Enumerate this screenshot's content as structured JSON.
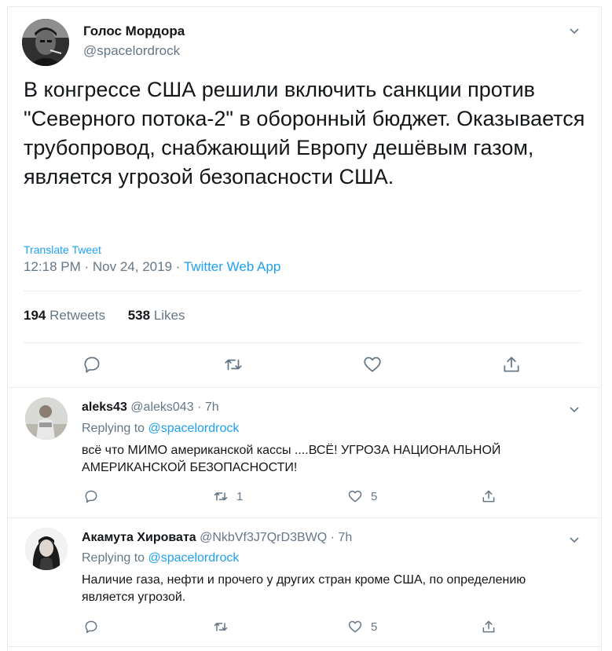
{
  "main_tweet": {
    "author_name": "Голос Мордора",
    "author_handle": "@spacelordrock",
    "text": "В конгрессе США решили включить санкции против \"Северного потока-2\" в оборонный бюджет. Оказывается трубопровод, снабжающий Европу дешёвым газом, является угрозой безопасности США.",
    "translate_label": "Translate Tweet",
    "time": "12:18 PM",
    "date": "Nov 24, 2019",
    "source": "Twitter Web App",
    "retweets_count": "194",
    "retweets_label": "Retweets",
    "likes_count": "538",
    "likes_label": "Likes"
  },
  "replies": [
    {
      "name": "aleks43",
      "handle": "@aleks043",
      "time": "7h",
      "replying_prefix": "Replying to",
      "replying_to": "@spacelordrock",
      "text": "всё что МИМО американской кассы ....ВСЁ! УГРОЗА НАЦИОНАЛЬНОЙ АМЕРИКАНСКОЙ БЕЗОПАСНОСТИ!",
      "retweets": "1",
      "likes": "5"
    },
    {
      "name": "Акамута Хировата",
      "handle": "@NkbVf3J7QrD3BWQ",
      "time": "7h",
      "replying_prefix": "Replying to",
      "replying_to": "@spacelordrock",
      "text": "Наличие газа, нефти и прочего у других стран кроме США, по определению является угрозой.",
      "retweets": "",
      "likes": "5"
    }
  ],
  "icons": {
    "reply": "reply-icon",
    "retweet": "retweet-icon",
    "like": "heart-icon",
    "share": "share-icon",
    "more": "chevron-down-icon"
  },
  "colors": {
    "accent": "#1da1f2",
    "secondary_text": "#657786",
    "primary_text": "#14171a",
    "border": "#e6ecf0"
  }
}
